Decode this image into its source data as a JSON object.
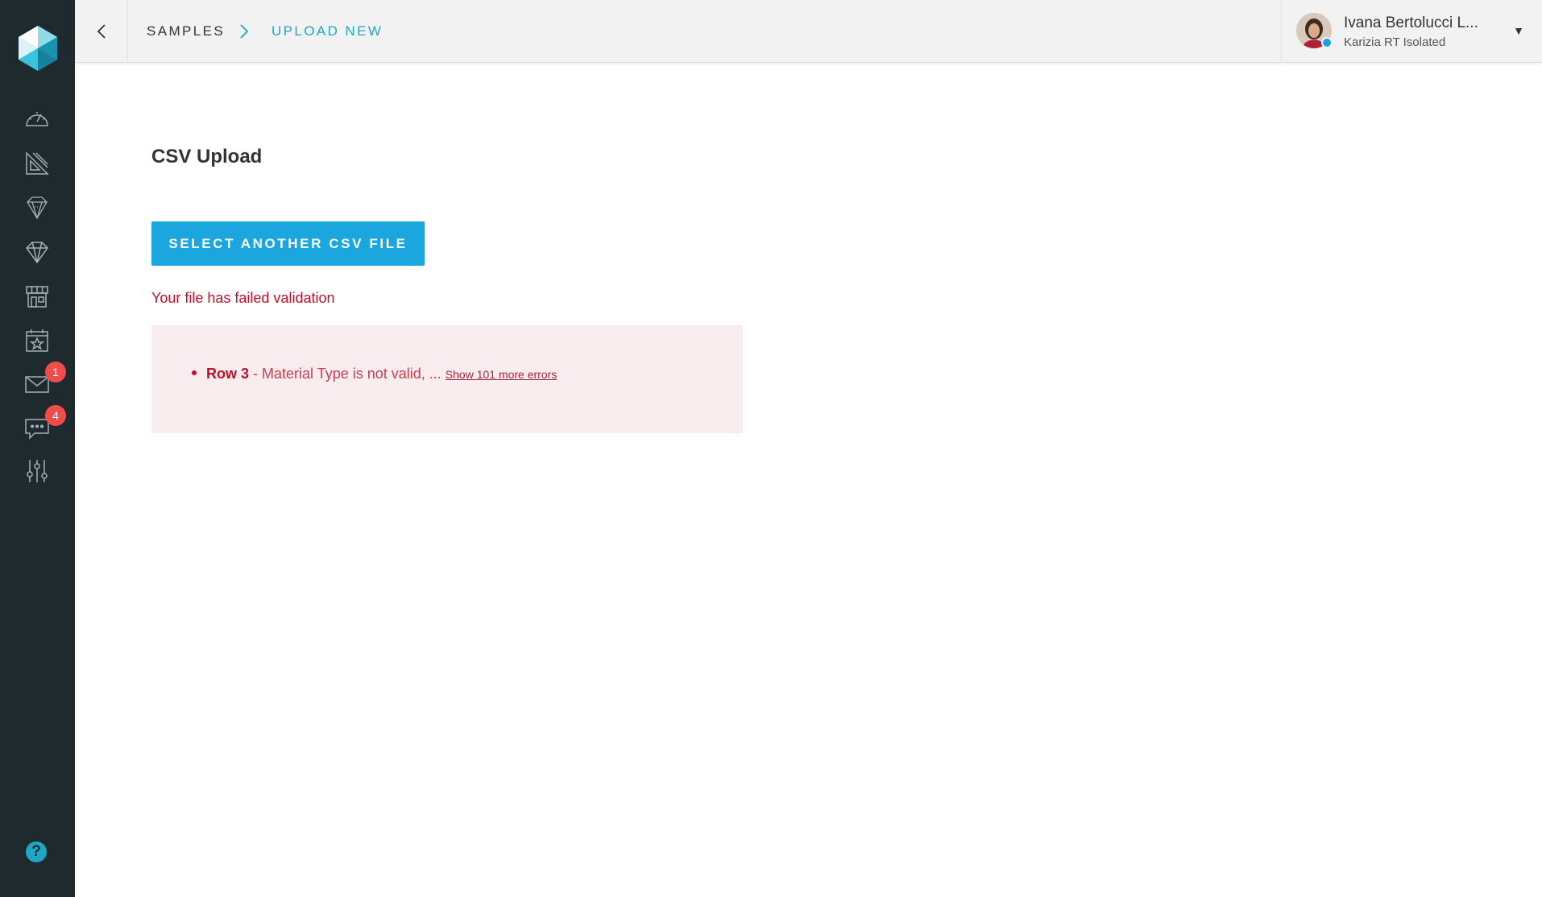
{
  "sidebar": {
    "items": [
      {
        "icon": "dashboard-gauge-icon"
      },
      {
        "icon": "design-ruler-icon"
      },
      {
        "icon": "loose-diamond-icon"
      },
      {
        "icon": "gemstone-icon"
      },
      {
        "icon": "storefront-icon"
      },
      {
        "icon": "calendar-star-icon"
      },
      {
        "icon": "mail-icon",
        "badge": "1"
      },
      {
        "icon": "chat-icon",
        "badge": "4"
      },
      {
        "icon": "settings-sliders-icon"
      }
    ],
    "help_label": "?"
  },
  "header": {
    "breadcrumb": {
      "parent": "SAMPLES",
      "current": "UPLOAD NEW"
    },
    "user": {
      "name": "Ivana Bertolucci L...",
      "org": "Karizia RT Isolated",
      "caret": "▼"
    }
  },
  "main": {
    "title": "CSV Upload",
    "select_button": "SELECT ANOTHER CSV FILE",
    "error_message": "Your file has failed validation",
    "errors": {
      "row_label": "Row 3",
      "detail": " - Material Type is not valid, ... ",
      "more_link": "Show 101 more errors"
    }
  },
  "colors": {
    "sidebar_bg": "#1f2a2e",
    "accent": "#21a6c4",
    "button": "#1ba6df",
    "error": "#c0112b",
    "error_bg": "#f8ecee",
    "badge": "#f04c4c"
  }
}
